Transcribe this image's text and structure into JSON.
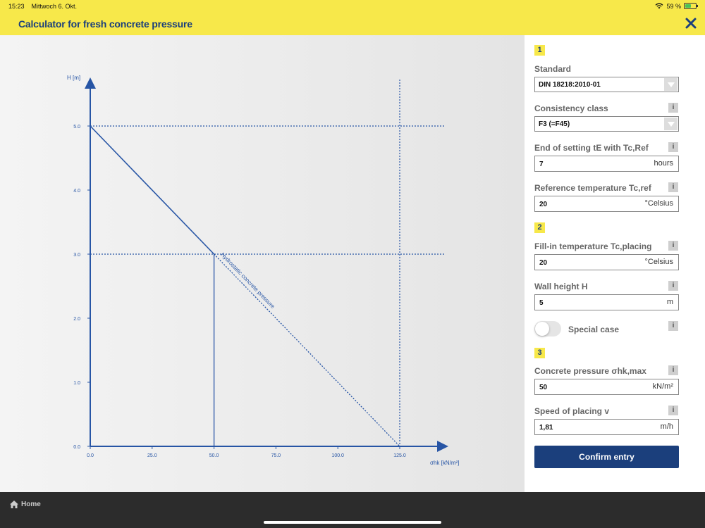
{
  "status": {
    "time": "15:23",
    "date": "Mittwoch 6. Okt.",
    "battery": "59 %",
    "battery_level": 0.59
  },
  "header": {
    "title": "Calculator for fresh concrete pressure"
  },
  "chart_data": {
    "type": "line",
    "xlabel": "σhk [kN/m²]",
    "ylabel": "H [m]",
    "xlim": [
      0,
      125
    ],
    "ylim": [
      0,
      5.0
    ],
    "x_ticks": [
      "0.0",
      "25.0",
      "50.0",
      "75.0",
      "100.0",
      "125.0"
    ],
    "y_ticks": [
      "0.0",
      "1.0",
      "2.0",
      "3.0",
      "4.0",
      "5.0"
    ],
    "series": [
      {
        "name": "Hydrostatic concrete pressure",
        "x": [
          0,
          50,
          125
        ],
        "y": [
          5.0,
          3.0,
          0.0
        ]
      }
    ],
    "reference_lines": {
      "h_lines_y": [
        5.0,
        3.0
      ],
      "v_lines_x": [
        125
      ],
      "solid_v_lines_x": [
        50
      ]
    },
    "annotation": "Hydrostatic concrete pressure"
  },
  "panel": {
    "step1": "1",
    "step2": "2",
    "step3": "3",
    "standard": {
      "label": "Standard",
      "value": "DIN 18218:2010-01"
    },
    "consistency": {
      "label": "Consistency class",
      "value": "F3 (=F45)"
    },
    "end_setting": {
      "label": "End of setting tE with Tc,Ref",
      "value": "7",
      "unit": "hours"
    },
    "ref_temp": {
      "label": "Reference temperature Tc,ref",
      "value": "20",
      "unit": "°Celsius"
    },
    "fill_temp": {
      "label": "Fill-in temperature Tc,placing",
      "value": "20",
      "unit": "°Celsius"
    },
    "wall_height": {
      "label": "Wall height H",
      "value": "5",
      "unit": "m"
    },
    "special_case": {
      "label": "Special case"
    },
    "pressure": {
      "label": "Concrete pressure σhk,max",
      "value": "50",
      "unit": "kN/m²"
    },
    "speed": {
      "label": "Speed of placing v",
      "value": "1,81",
      "unit": "m/h"
    },
    "info_glyph": "i",
    "confirm_label": "Confirm entry"
  },
  "footer": {
    "home_label": "Home"
  },
  "colors": {
    "accent": "#f7e84a",
    "brand": "#1b3f7c",
    "line": "#2755a5"
  }
}
